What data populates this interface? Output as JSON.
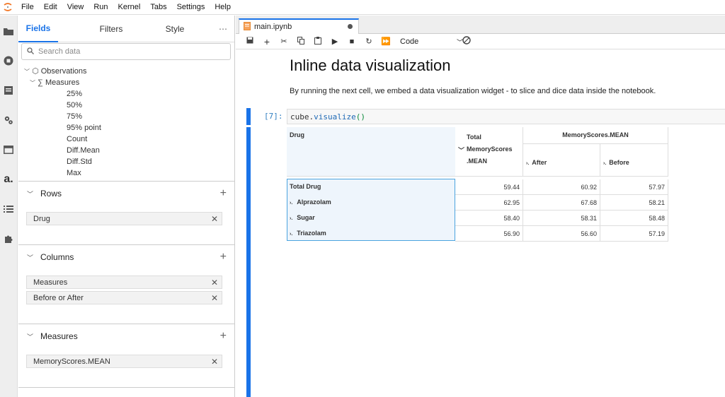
{
  "menubar": {
    "items": [
      "File",
      "Edit",
      "View",
      "Run",
      "Kernel",
      "Tabs",
      "Settings",
      "Help"
    ]
  },
  "sidepanel": {
    "tabs": [
      "Fields",
      "Filters",
      "Style"
    ],
    "more": "⋯",
    "search_placeholder": "Search data",
    "tree": {
      "root": "Observations",
      "group": "Measures",
      "items": [
        "25%",
        "50%",
        "75%",
        "95% point",
        "Count",
        "Diff.Mean",
        "Diff.Std",
        "Max"
      ]
    },
    "rows": {
      "title": "Rows",
      "chips": [
        "Drug"
      ]
    },
    "columns": {
      "title": "Columns",
      "chips": [
        "Measures",
        "Before or After"
      ]
    },
    "measures": {
      "title": "Measures",
      "chips": [
        "MemoryScores.MEAN"
      ]
    }
  },
  "notebook": {
    "tab_title": "main.ipynb",
    "cell_type": "Code",
    "heading": "Inline data visualization",
    "paragraph": "By running the next cell, we embed a data visualization widget - to slice and dice data inside the notebook.",
    "prompt": "[7]:",
    "code": {
      "obj": "cube.",
      "fn": "visualize",
      "args": "()"
    }
  },
  "pivot": {
    "row_header": "Drug",
    "total_header": [
      "Total",
      "MemoryScores",
      ".MEAN"
    ],
    "group_header": "MemoryScores.MEAN",
    "col_after": "After",
    "col_before": "Before",
    "rows": [
      {
        "label": "Total Drug",
        "total": "59.44",
        "after": "60.92",
        "before": "57.97"
      },
      {
        "label": "Alprazolam",
        "total": "62.95",
        "after": "67.68",
        "before": "58.21"
      },
      {
        "label": "Sugar",
        "total": "58.40",
        "after": "58.31",
        "before": "58.48"
      },
      {
        "label": "Triazolam",
        "total": "56.90",
        "after": "56.60",
        "before": "57.19"
      }
    ]
  },
  "colors": {
    "accent": "#1a73e8",
    "selection": "#4aa3df"
  }
}
